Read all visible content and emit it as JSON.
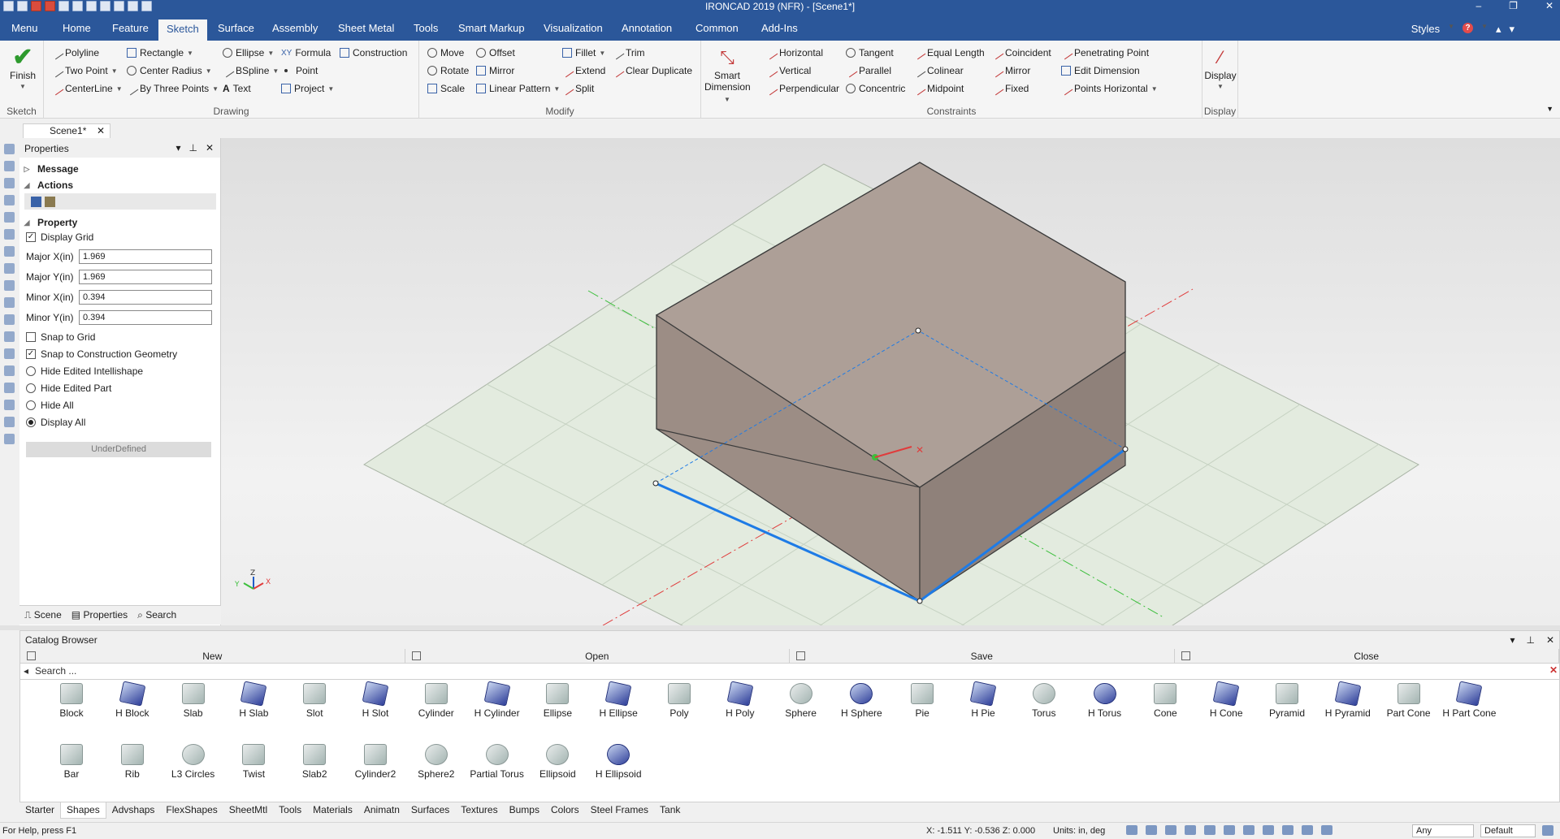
{
  "window": {
    "title": "IRONCAD 2019 (NFR) - [Scene1*]",
    "controls": [
      "–",
      "❐",
      "✕"
    ]
  },
  "menu": {
    "tabs": [
      "Menu",
      "Home",
      "Feature",
      "Sketch",
      "Surface",
      "Assembly",
      "Sheet Metal",
      "Tools",
      "Smart Markup",
      "Visualization",
      "Annotation",
      "Common",
      "Add-Ins"
    ],
    "active": "Sketch",
    "styles_label": "Styles"
  },
  "ribbon": {
    "sketch": {
      "finish": "Finish",
      "group": "Sketch"
    },
    "drawing": {
      "group": "Drawing",
      "items": [
        "Polyline",
        "Two Point",
        "CenterLine",
        "Rectangle",
        "Center Radius",
        "By Three Points",
        "Ellipse",
        "BSpline",
        "Text",
        "Formula",
        "Point",
        "Project",
        "Construction"
      ]
    },
    "modify": {
      "group": "Modify",
      "items": [
        "Move",
        "Rotate",
        "Scale",
        "Offset",
        "Mirror",
        "Linear Pattern",
        "Fillet",
        "Extend",
        "Split",
        "Trim",
        "Clear Duplicate"
      ]
    },
    "constraints": {
      "group": "Constraints",
      "smart_dimension": [
        "Smart",
        "Dimension"
      ],
      "items": [
        "Horizontal",
        "Vertical",
        "Perpendicular",
        "Tangent",
        "Parallel",
        "Concentric",
        "Equal Length",
        "Colinear",
        "Midpoint",
        "Coincident",
        "Mirror",
        "Fixed",
        "Penetrating Point",
        "Edit Dimension",
        "Points Horizontal"
      ]
    },
    "display": {
      "label": "Display",
      "group": "Display"
    }
  },
  "doc_tab": {
    "label": "Scene1*"
  },
  "properties": {
    "title": "Properties",
    "message": "Message",
    "actions": "Actions",
    "property": "Property",
    "display_grid": {
      "label": "Display Grid",
      "checked": true
    },
    "fields": [
      {
        "label": "Major X(in)",
        "value": "1.969"
      },
      {
        "label": "Major Y(in)",
        "value": "1.969"
      },
      {
        "label": "Minor X(in)",
        "value": "0.394"
      },
      {
        "label": "Minor Y(in)",
        "value": "0.394"
      }
    ],
    "snap_grid": {
      "label": "Snap to Grid",
      "checked": false
    },
    "snap_construction": {
      "label": "Snap to Construction Geometry",
      "checked": true
    },
    "radios": [
      {
        "label": "Hide Edited Intellishape",
        "selected": false
      },
      {
        "label": "Hide Edited Part",
        "selected": false
      },
      {
        "label": "Hide All",
        "selected": false
      },
      {
        "label": "Display All",
        "selected": true
      }
    ],
    "status": "UnderDefined",
    "bottom_tabs": [
      "Scene",
      "Properties",
      "Search"
    ]
  },
  "catalog": {
    "title": "Catalog Browser",
    "buttons": [
      "New",
      "Open",
      "Save",
      "Close"
    ],
    "search_placeholder": "Search ...",
    "row1": [
      "Block",
      "H Block",
      "Slab",
      "H Slab",
      "Slot",
      "H Slot",
      "Cylinder",
      "H Cylinder",
      "Ellipse",
      "H Ellipse",
      "Poly",
      "H Poly",
      "Sphere",
      "H Sphere",
      "Pie",
      "H Pie",
      "Torus",
      "H Torus",
      "Cone",
      "H Cone",
      "Pyramid",
      "H Pyramid",
      "Part Cone",
      "H Part Cone"
    ],
    "row2": [
      "Bar",
      "Rib",
      "L3 Circles",
      "Twist",
      "Slab2",
      "Cylinder2",
      "Sphere2",
      "Partial Torus",
      "Ellipsoid",
      "H Ellipsoid"
    ],
    "tabs": [
      "Starter",
      "Shapes",
      "Advshaps",
      "FlexShapes",
      "SheetMtl",
      "Tools",
      "Materials",
      "Animatn",
      "Surfaces",
      "Textures",
      "Bumps",
      "Colors",
      "Steel Frames",
      "Tank"
    ],
    "active_tab": "Shapes"
  },
  "status": {
    "help": "For Help, press F1",
    "coords": "X: -1.511 Y: -0.536 Z: 0.000",
    "units": "Units: in, deg",
    "filter": "Any",
    "mode": "Default"
  },
  "colors": {
    "accent": "#2b579a",
    "selection": "#1e7be6",
    "block": "#ad9f97"
  }
}
